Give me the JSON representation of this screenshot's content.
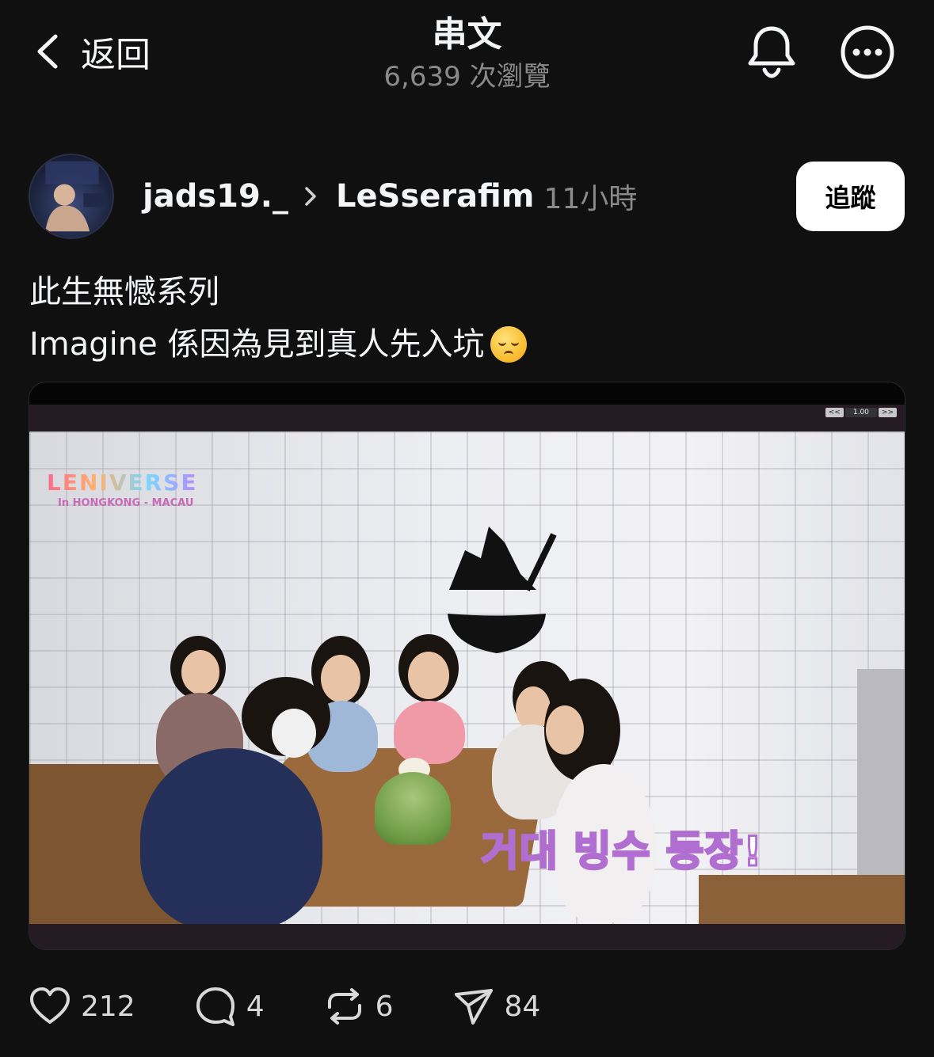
{
  "header": {
    "back_label": "返回",
    "title": "串文",
    "subtitle": "6,639 次瀏覽"
  },
  "post": {
    "author": "jads19._",
    "community": "LeSserafim",
    "time": "11小時",
    "follow_label": "追蹤",
    "text_lines": [
      "此生無憾系列",
      "Imagine 係因為見到真人先入坑"
    ],
    "emoji": "pensive-face",
    "media": {
      "overlay_logo": "LENIVERSE",
      "overlay_logo_sub": "In HONGKONG - MACAU",
      "caption": "거대 빙수 등장!",
      "playback_speed": "1.00",
      "speed_prev": "<<",
      "speed_next": ">>"
    }
  },
  "actions": {
    "likes": "212",
    "replies": "4",
    "reposts": "6",
    "shares": "84"
  },
  "colors": {
    "background": "#101010",
    "text": "#f3f5f7",
    "muted": "#8a8a8a",
    "follow_bg": "#ffffff"
  }
}
